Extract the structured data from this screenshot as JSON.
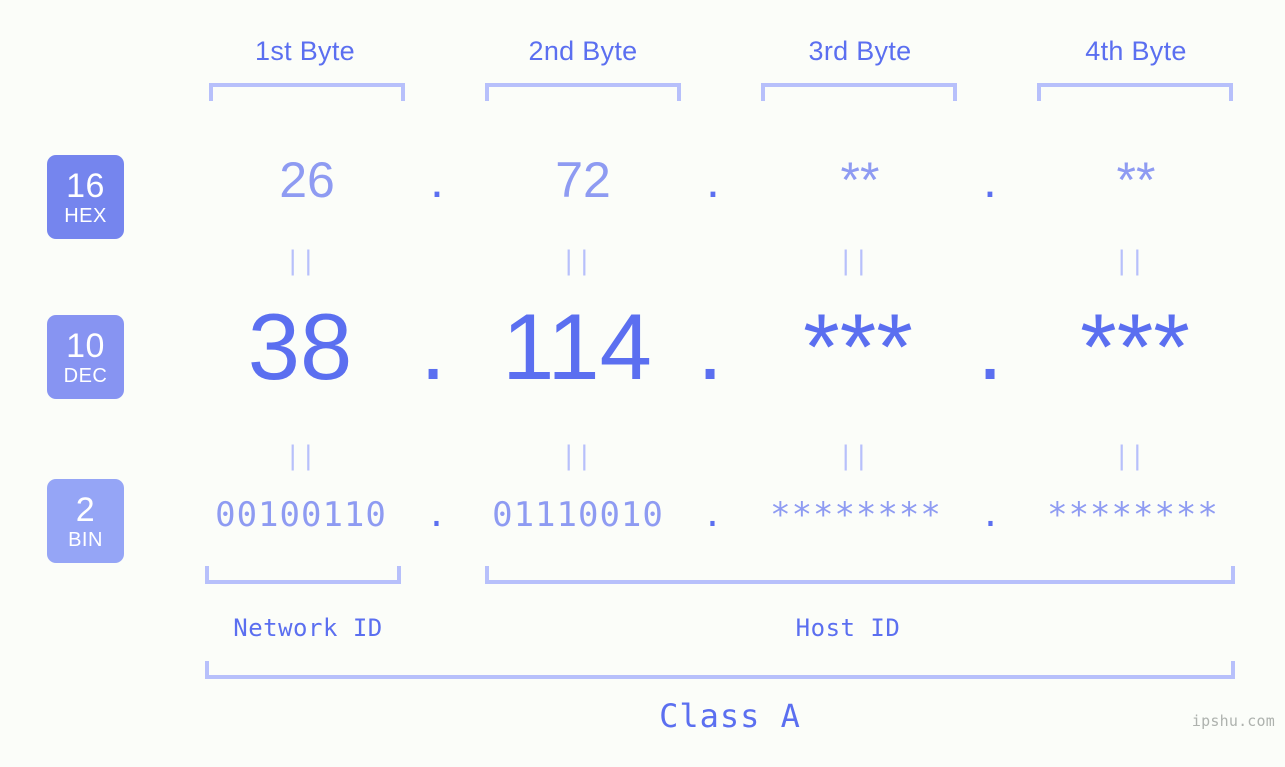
{
  "background_color": "#fbfdf9",
  "accent_color": "#5b6ff0",
  "accent_light_color": "#8e9bf2",
  "bracket_color": "#b7c0fb",
  "headers": [
    {
      "label": "1st Byte"
    },
    {
      "label": "2nd Byte"
    },
    {
      "label": "3rd Byte"
    },
    {
      "label": "4th Byte"
    }
  ],
  "bases": [
    {
      "number": "16",
      "abbr": "HEX",
      "color": "#7585ee"
    },
    {
      "number": "10",
      "abbr": "DEC",
      "color": "#8794f2"
    },
    {
      "number": "2",
      "abbr": "BIN",
      "color": "#95a5f6"
    }
  ],
  "rows": {
    "hex": {
      "values": [
        "26",
        "72",
        "**",
        "**"
      ],
      "separator": "."
    },
    "dec": {
      "values": [
        "38",
        "114",
        "***",
        "***"
      ],
      "separator": "."
    },
    "bin": {
      "values": [
        "00100110",
        "01110010",
        "********",
        "********"
      ],
      "separator": "."
    }
  },
  "equals_marker": "||",
  "segments": {
    "network_id": "Network ID",
    "host_id": "Host ID",
    "class": "Class A"
  },
  "watermark": "ipshu.com"
}
